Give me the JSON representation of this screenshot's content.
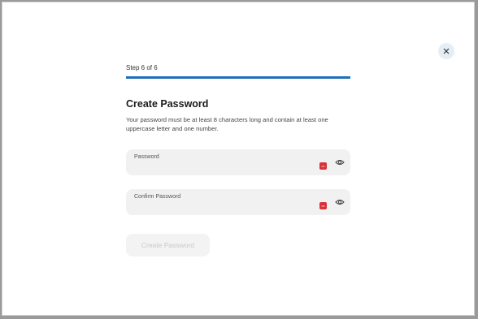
{
  "step": {
    "label": "Step 6 of 6",
    "progress": 1.0
  },
  "heading": {
    "title": "Create Password"
  },
  "description": "Your password must be at least 8 characters long and contain at least one uppercase letter and one number.",
  "fields": {
    "password": {
      "label": "Password",
      "value": ""
    },
    "confirm": {
      "label": "Confirm Password",
      "value": ""
    }
  },
  "submit": {
    "label": "Create Password",
    "disabled": true
  },
  "colors": {
    "accent": "#1f6fb8",
    "password_manager": "#d9333a"
  }
}
